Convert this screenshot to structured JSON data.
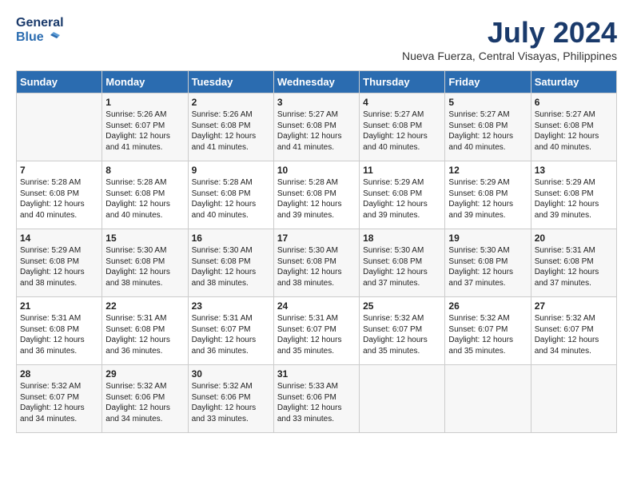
{
  "header": {
    "logo_line1": "General",
    "logo_line2": "Blue",
    "month_year": "July 2024",
    "location": "Nueva Fuerza, Central Visayas, Philippines"
  },
  "weekdays": [
    "Sunday",
    "Monday",
    "Tuesday",
    "Wednesday",
    "Thursday",
    "Friday",
    "Saturday"
  ],
  "weeks": [
    [
      {
        "day": "",
        "sunrise": "",
        "sunset": "",
        "daylight": ""
      },
      {
        "day": "1",
        "sunrise": "Sunrise: 5:26 AM",
        "sunset": "Sunset: 6:07 PM",
        "daylight": "Daylight: 12 hours and 41 minutes."
      },
      {
        "day": "2",
        "sunrise": "Sunrise: 5:26 AM",
        "sunset": "Sunset: 6:08 PM",
        "daylight": "Daylight: 12 hours and 41 minutes."
      },
      {
        "day": "3",
        "sunrise": "Sunrise: 5:27 AM",
        "sunset": "Sunset: 6:08 PM",
        "daylight": "Daylight: 12 hours and 41 minutes."
      },
      {
        "day": "4",
        "sunrise": "Sunrise: 5:27 AM",
        "sunset": "Sunset: 6:08 PM",
        "daylight": "Daylight: 12 hours and 40 minutes."
      },
      {
        "day": "5",
        "sunrise": "Sunrise: 5:27 AM",
        "sunset": "Sunset: 6:08 PM",
        "daylight": "Daylight: 12 hours and 40 minutes."
      },
      {
        "day": "6",
        "sunrise": "Sunrise: 5:27 AM",
        "sunset": "Sunset: 6:08 PM",
        "daylight": "Daylight: 12 hours and 40 minutes."
      }
    ],
    [
      {
        "day": "7",
        "sunrise": "Sunrise: 5:28 AM",
        "sunset": "Sunset: 6:08 PM",
        "daylight": "Daylight: 12 hours and 40 minutes."
      },
      {
        "day": "8",
        "sunrise": "Sunrise: 5:28 AM",
        "sunset": "Sunset: 6:08 PM",
        "daylight": "Daylight: 12 hours and 40 minutes."
      },
      {
        "day": "9",
        "sunrise": "Sunrise: 5:28 AM",
        "sunset": "Sunset: 6:08 PM",
        "daylight": "Daylight: 12 hours and 40 minutes."
      },
      {
        "day": "10",
        "sunrise": "Sunrise: 5:28 AM",
        "sunset": "Sunset: 6:08 PM",
        "daylight": "Daylight: 12 hours and 39 minutes."
      },
      {
        "day": "11",
        "sunrise": "Sunrise: 5:29 AM",
        "sunset": "Sunset: 6:08 PM",
        "daylight": "Daylight: 12 hours and 39 minutes."
      },
      {
        "day": "12",
        "sunrise": "Sunrise: 5:29 AM",
        "sunset": "Sunset: 6:08 PM",
        "daylight": "Daylight: 12 hours and 39 minutes."
      },
      {
        "day": "13",
        "sunrise": "Sunrise: 5:29 AM",
        "sunset": "Sunset: 6:08 PM",
        "daylight": "Daylight: 12 hours and 39 minutes."
      }
    ],
    [
      {
        "day": "14",
        "sunrise": "Sunrise: 5:29 AM",
        "sunset": "Sunset: 6:08 PM",
        "daylight": "Daylight: 12 hours and 38 minutes."
      },
      {
        "day": "15",
        "sunrise": "Sunrise: 5:30 AM",
        "sunset": "Sunset: 6:08 PM",
        "daylight": "Daylight: 12 hours and 38 minutes."
      },
      {
        "day": "16",
        "sunrise": "Sunrise: 5:30 AM",
        "sunset": "Sunset: 6:08 PM",
        "daylight": "Daylight: 12 hours and 38 minutes."
      },
      {
        "day": "17",
        "sunrise": "Sunrise: 5:30 AM",
        "sunset": "Sunset: 6:08 PM",
        "daylight": "Daylight: 12 hours and 38 minutes."
      },
      {
        "day": "18",
        "sunrise": "Sunrise: 5:30 AM",
        "sunset": "Sunset: 6:08 PM",
        "daylight": "Daylight: 12 hours and 37 minutes."
      },
      {
        "day": "19",
        "sunrise": "Sunrise: 5:30 AM",
        "sunset": "Sunset: 6:08 PM",
        "daylight": "Daylight: 12 hours and 37 minutes."
      },
      {
        "day": "20",
        "sunrise": "Sunrise: 5:31 AM",
        "sunset": "Sunset: 6:08 PM",
        "daylight": "Daylight: 12 hours and 37 minutes."
      }
    ],
    [
      {
        "day": "21",
        "sunrise": "Sunrise: 5:31 AM",
        "sunset": "Sunset: 6:08 PM",
        "daylight": "Daylight: 12 hours and 36 minutes."
      },
      {
        "day": "22",
        "sunrise": "Sunrise: 5:31 AM",
        "sunset": "Sunset: 6:08 PM",
        "daylight": "Daylight: 12 hours and 36 minutes."
      },
      {
        "day": "23",
        "sunrise": "Sunrise: 5:31 AM",
        "sunset": "Sunset: 6:07 PM",
        "daylight": "Daylight: 12 hours and 36 minutes."
      },
      {
        "day": "24",
        "sunrise": "Sunrise: 5:31 AM",
        "sunset": "Sunset: 6:07 PM",
        "daylight": "Daylight: 12 hours and 35 minutes."
      },
      {
        "day": "25",
        "sunrise": "Sunrise: 5:32 AM",
        "sunset": "Sunset: 6:07 PM",
        "daylight": "Daylight: 12 hours and 35 minutes."
      },
      {
        "day": "26",
        "sunrise": "Sunrise: 5:32 AM",
        "sunset": "Sunset: 6:07 PM",
        "daylight": "Daylight: 12 hours and 35 minutes."
      },
      {
        "day": "27",
        "sunrise": "Sunrise: 5:32 AM",
        "sunset": "Sunset: 6:07 PM",
        "daylight": "Daylight: 12 hours and 34 minutes."
      }
    ],
    [
      {
        "day": "28",
        "sunrise": "Sunrise: 5:32 AM",
        "sunset": "Sunset: 6:07 PM",
        "daylight": "Daylight: 12 hours and 34 minutes."
      },
      {
        "day": "29",
        "sunrise": "Sunrise: 5:32 AM",
        "sunset": "Sunset: 6:06 PM",
        "daylight": "Daylight: 12 hours and 34 minutes."
      },
      {
        "day": "30",
        "sunrise": "Sunrise: 5:32 AM",
        "sunset": "Sunset: 6:06 PM",
        "daylight": "Daylight: 12 hours and 33 minutes."
      },
      {
        "day": "31",
        "sunrise": "Sunrise: 5:33 AM",
        "sunset": "Sunset: 6:06 PM",
        "daylight": "Daylight: 12 hours and 33 minutes."
      },
      {
        "day": "",
        "sunrise": "",
        "sunset": "",
        "daylight": ""
      },
      {
        "day": "",
        "sunrise": "",
        "sunset": "",
        "daylight": ""
      },
      {
        "day": "",
        "sunrise": "",
        "sunset": "",
        "daylight": ""
      }
    ]
  ]
}
